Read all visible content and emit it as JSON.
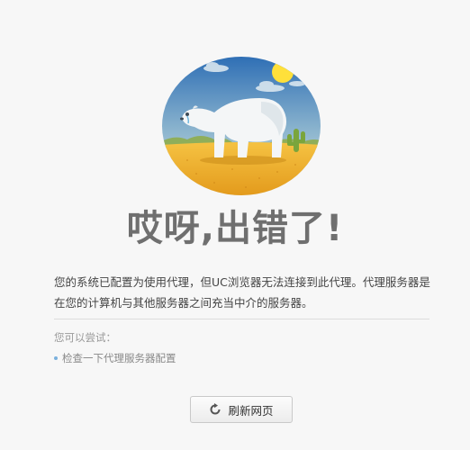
{
  "error": {
    "headline": "哎呀,出错了!",
    "description": "您的系统已配置为使用代理，但UC浏览器无法连接到此代理。代理服务器是在您的计算机与其他服务器之间充当中介的服务器。",
    "try_label": "您可以尝试：",
    "suggestions": [
      "检查一下代理服务器配置"
    ]
  },
  "refresh_button": {
    "label": "刷新网页",
    "icon": "refresh-icon"
  },
  "illustration": {
    "icon": "polar-bear-desert-illustration",
    "colors": {
      "sky_top": "#2f6fb5",
      "sky_bottom": "#cfe0e6",
      "sand": "#f2b630",
      "sun": "#ffe03a",
      "cactus": "#7aa53c"
    }
  },
  "colors": {
    "background": "#f7f7f7",
    "headline": "#6f6f6f",
    "accent": "#7ab0dd"
  }
}
